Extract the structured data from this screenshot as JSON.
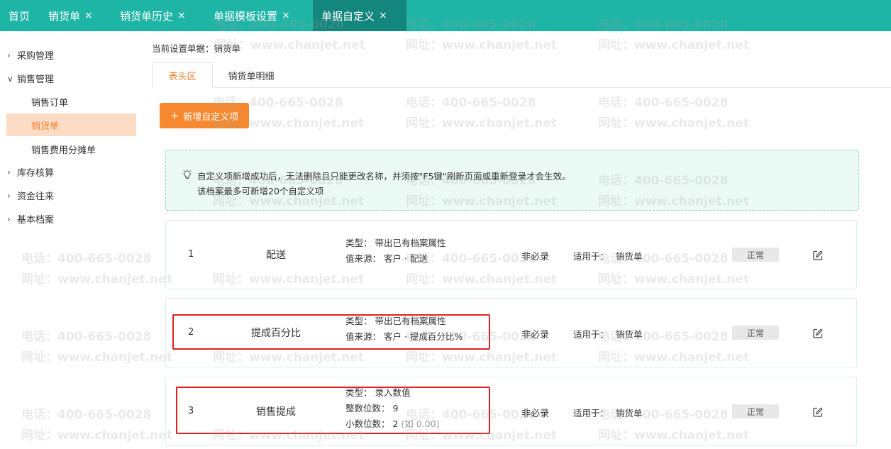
{
  "topbar": {
    "tabs": [
      {
        "label": "首页",
        "closable": false
      },
      {
        "label": "销货单",
        "closable": true
      },
      {
        "label": "销货单历史",
        "closable": true
      },
      {
        "label": "单据模板设置",
        "closable": true
      },
      {
        "label": "单据自定义",
        "closable": true,
        "active": true
      }
    ],
    "close_glyph": "×"
  },
  "sidebar": {
    "groups": [
      {
        "label": "采购管理",
        "expanded": false
      },
      {
        "label": "销售管理",
        "expanded": true,
        "children": [
          "销售订单",
          "销货单",
          "销售费用分摊单"
        ],
        "active_child": "销货单"
      },
      {
        "label": "库存核算",
        "expanded": false
      },
      {
        "label": "资金往来",
        "expanded": false
      },
      {
        "label": "基本档案",
        "expanded": false
      }
    ]
  },
  "main": {
    "current_doc": "当前设置单据：销货单",
    "tabs": [
      "表头区",
      "销货单明细"
    ],
    "active_tab": "表头区",
    "add_button": "新增自定义项",
    "notice": {
      "line1": "自定义项新增成功后，无法删除且只能更改名称，并须按\"F5键\"刷新页面或重新登录才会生效。",
      "line2": "该档案最多可新增20个自定义项"
    },
    "rows": [
      {
        "index": "1",
        "name": "配送",
        "type": "类型： 带出已有档案属性",
        "source": "值来源： 客户 · 配送",
        "required": "非必录",
        "apply_label": "适用于：",
        "apply_value": "销货单",
        "status": "正常"
      },
      {
        "index": "2",
        "name": "提成百分比",
        "type": "类型： 带出已有档案属性",
        "source": "值来源： 客户 · 提成百分比%",
        "required": "非必录",
        "apply_label": "适用于：",
        "apply_value": "销货单",
        "status": "正常"
      },
      {
        "index": "3",
        "name": "销售提成",
        "type": "类型： 录入数值",
        "int_digits": "整数位数： 9",
        "dec_digits": "小数位数： 2",
        "dec_example": "(如 0.00)",
        "required": "非必录",
        "apply_label": "适用于：",
        "apply_value": "销货单",
        "status": "正常"
      }
    ]
  },
  "watermark": {
    "phone": "电话：400-665-0028",
    "site": "网址：www.chanjet.net"
  },
  "colors": {
    "teal": "#1fb5a6",
    "teal_dark": "#13877d",
    "orange": "#f6892f",
    "highlight_red": "#e02020"
  }
}
